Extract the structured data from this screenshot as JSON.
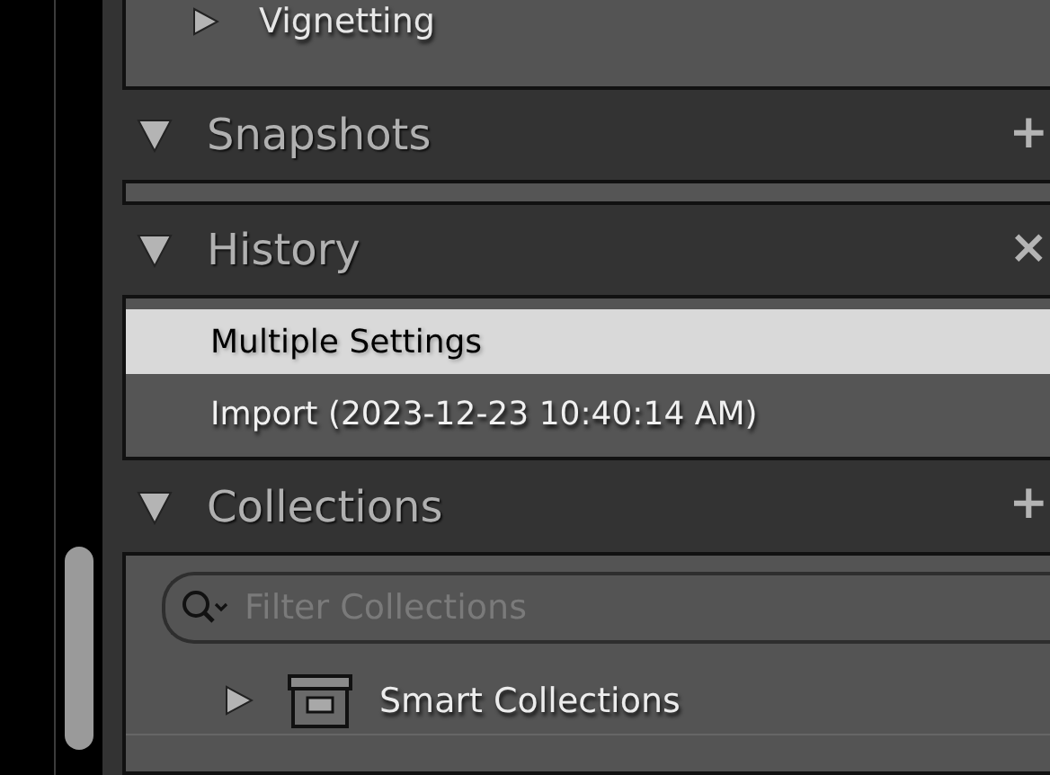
{
  "top_panel": {
    "items": [
      {
        "label": "Vignetting",
        "expanded": false
      }
    ]
  },
  "panels": [
    {
      "title": "Snapshots",
      "expanded": true,
      "action": "+"
    },
    {
      "title": "History",
      "expanded": true,
      "action": "×",
      "items": [
        {
          "label": "Multiple Settings",
          "selected": true
        },
        {
          "label": "Import (2023-12-23 10:40:14 AM)",
          "selected": false
        }
      ]
    },
    {
      "title": "Collections",
      "expanded": true,
      "action": "+",
      "search": {
        "placeholder": "Filter Collections"
      },
      "items": [
        {
          "label": "Smart Collections",
          "expanded": false
        }
      ]
    }
  ]
}
